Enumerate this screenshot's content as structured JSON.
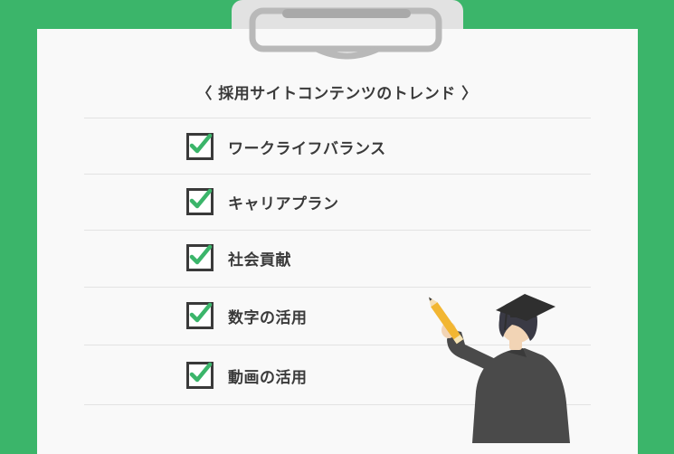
{
  "heading": "〈 採用サイトコンテンツのトレンド 〉",
  "checklist": [
    {
      "label": "ワークライフバランス",
      "checked": true
    },
    {
      "label": "キャリアプラン",
      "checked": true
    },
    {
      "label": "社会貢献",
      "checked": true
    },
    {
      "label": "数字の活用",
      "checked": true
    },
    {
      "label": "動画の活用",
      "checked": true
    }
  ],
  "colors": {
    "background": "#3bb56a",
    "paper": "#f9f9f9",
    "check": "#3bb56a",
    "text": "#3a3a3a"
  },
  "icons": {
    "clip": "clipboard-clip-icon",
    "checkbox": "checked-checkbox-icon",
    "illustration": "graduate-with-pencil-illustration"
  }
}
